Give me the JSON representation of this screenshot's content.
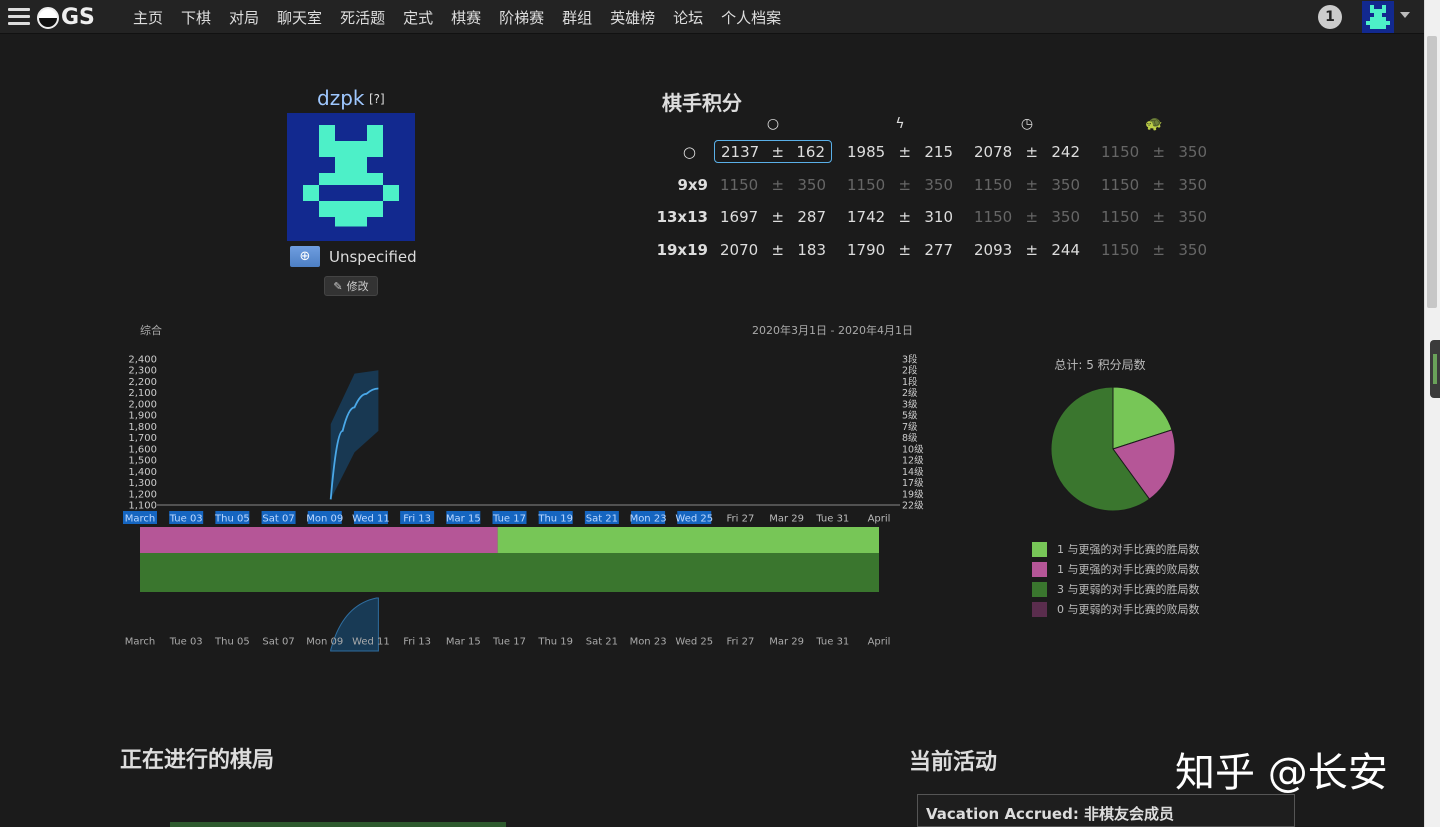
{
  "nav": {
    "logo_text": "GS",
    "items": [
      "主页",
      "下棋",
      "对局",
      "聊天室",
      "死活题",
      "定式",
      "棋赛",
      "阶梯赛",
      "群组",
      "英雄榜",
      "论坛",
      "个人档案"
    ],
    "notification_count": "1"
  },
  "profile": {
    "username": "dzpk",
    "help_mark": "[?]",
    "country": "Unspecified",
    "edit_label": "修改"
  },
  "ratings": {
    "title": "棋手积分",
    "columns": [
      "overall-icon",
      "blitz-icon",
      "live-icon",
      "correspondence-icon"
    ],
    "rows": [
      {
        "label": "",
        "cells": [
          [
            "2137",
            "±",
            "162"
          ],
          [
            "1985",
            "±",
            "215"
          ],
          [
            "2078",
            "±",
            "242"
          ],
          [
            "1150",
            "±",
            "350"
          ]
        ]
      },
      {
        "label": "9x9",
        "cells": [
          [
            "1150",
            "±",
            "350"
          ],
          [
            "1150",
            "±",
            "350"
          ],
          [
            "1150",
            "±",
            "350"
          ],
          [
            "1150",
            "±",
            "350"
          ]
        ]
      },
      {
        "label": "13x13",
        "cells": [
          [
            "1697",
            "±",
            "287"
          ],
          [
            "1742",
            "±",
            "310"
          ],
          [
            "1150",
            "±",
            "350"
          ],
          [
            "1150",
            "±",
            "350"
          ]
        ]
      },
      {
        "label": "19x19",
        "cells": [
          [
            "2070",
            "±",
            "183"
          ],
          [
            "1790",
            "±",
            "277"
          ],
          [
            "2093",
            "±",
            "244"
          ],
          [
            "1150",
            "±",
            "350"
          ]
        ]
      }
    ]
  },
  "chart_data": [
    {
      "type": "line",
      "title": "综合",
      "subtitle": "2020年3月1日 - 2020年4月1日",
      "x_ticks": [
        "March",
        "Tue 03",
        "Thu 05",
        "Sat 07",
        "Mon 09",
        "Wed 11",
        "Fri 13",
        "Mar 15",
        "Tue 17",
        "Thu 19",
        "Sat 21",
        "Mon 23",
        "Wed 25",
        "Fri 27",
        "Mar 29",
        "Tue 31",
        "April"
      ],
      "y_ticks": [
        1100,
        1200,
        1300,
        1400,
        1500,
        1600,
        1700,
        1800,
        1900,
        2000,
        2100,
        2200,
        2300,
        2400
      ],
      "y2_ticks": [
        "3段",
        "2段",
        "1段",
        "2级",
        "3级",
        "5级",
        "7级",
        "8级",
        "10级",
        "12级",
        "14级",
        "17级",
        "19级",
        "22级"
      ],
      "ylim": [
        1100,
        2400
      ],
      "x_range": [
        "2020-03-01",
        "2020-04-01"
      ],
      "series": [
        {
          "x": [
            "2020-03-09",
            "2020-03-09 12:00",
            "2020-03-10",
            "2020-03-10 12:00",
            "2020-03-11"
          ],
          "y": [
            1150,
            1760,
            1970,
            2090,
            2137
          ]
        }
      ],
      "band": {
        "x": [
          "2020-03-09",
          "2020-03-10",
          "2020-03-11"
        ],
        "upper": [
          1820,
          2270,
          2300
        ],
        "lower": [
          1150,
          1570,
          1760
        ]
      },
      "highlighted_ticks_through": "Wed 25"
    },
    {
      "type": "bar",
      "series": [
        {
          "name": "win_vs_stronger",
          "ranges": [
            [
              "2020-03-16",
              "2020-04-01"
            ]
          ],
          "color": "#77c657"
        },
        {
          "name": "loss_vs_stronger",
          "ranges": [
            [
              "2020-03-01",
              "2020-03-16"
            ]
          ],
          "color": "#b55697"
        },
        {
          "name": "win_vs_weaker",
          "ranges": [
            [
              "2020-03-01",
              "2020-04-01"
            ]
          ],
          "color": "#3a762e"
        }
      ]
    },
    {
      "type": "area",
      "x_ticks": [
        "March",
        "Tue 03",
        "Thu 05",
        "Sat 07",
        "Mon 09",
        "Wed 11",
        "Fri 13",
        "Mar 15",
        "Tue 17",
        "Thu 19",
        "Sat 21",
        "Mon 23",
        "Wed 25",
        "Fri 27",
        "Mar 29",
        "Tue 31",
        "April"
      ],
      "selection": [
        "2020-03-09",
        "2020-03-11"
      ]
    },
    {
      "type": "pie",
      "title": "总计: 5 积分局数",
      "slices": [
        {
          "label": "1 与更强的对手比赛的胜局数",
          "value": 1,
          "color": "#77c657"
        },
        {
          "label": "1 与更强的对手比赛的败局数",
          "value": 1,
          "color": "#b55697"
        },
        {
          "label": "3 与更弱的对手比赛的胜局数",
          "value": 3,
          "color": "#3a762e"
        },
        {
          "label": "0 与更弱的对手比赛的败局数",
          "value": 0,
          "color": "#5a2d4d"
        }
      ]
    }
  ],
  "sections": {
    "ongoing_games": "正在进行的棋局",
    "current_activity": "当前活动",
    "activity_item": "Vacation Accrued: 非棋友会成员"
  },
  "watermark": "知乎 @长安"
}
